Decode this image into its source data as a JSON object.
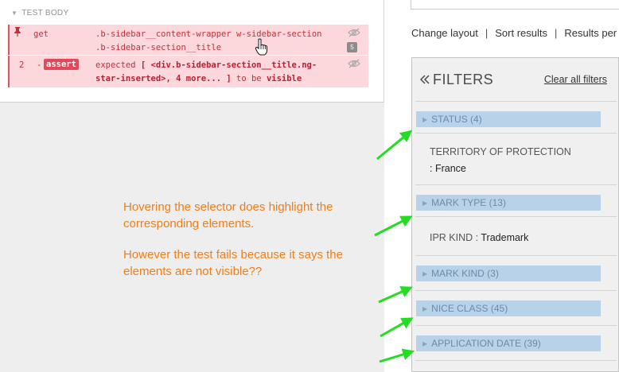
{
  "cypress": {
    "section_label": "TEST BODY",
    "command1": {
      "name": "get",
      "selector_line1": ".b-sidebar__content-wrapper w-sidebar-section",
      "selector_line2": ".b-sidebar-section__title",
      "count": "5"
    },
    "command2": {
      "number": "2",
      "dash": "-",
      "name": "assert",
      "msg_line1_a": "expected",
      "msg_line1_b": "[ <div.b-sidebar-section__title.ng-",
      "msg_line2_a": "star-inserted>, 4 more... ]",
      "msg_line2_b": "to be",
      "msg_line2_c": "visible"
    }
  },
  "annotation": {
    "line1": "Hovering the selector does highlight the corresponding elements.",
    "line2": "However the test fails because it says the elements are not visible??"
  },
  "app": {
    "layout_bar": {
      "change_layout": "Change layout",
      "separator": "|",
      "sort_results": "Sort results",
      "results_per": "Results per"
    },
    "filters": {
      "title": "FILTERS",
      "clear_all": "Clear all filters",
      "status": "STATUS (4)",
      "territory_label": "TERRITORY OF PROTECTION",
      "territory_value": ": France",
      "mark_type": "MARK TYPE (13)",
      "ipr_label": "IPR KIND : ",
      "ipr_value": "Trademark",
      "mark_kind": "MARK KIND (3)",
      "nice_class": "NICE CLASS (45)",
      "application_date": "APPLICATION DATE (39)"
    }
  },
  "colors": {
    "cypress_fail_bg": "#fcd7db",
    "cypress_fail_text": "#c0303e",
    "assert_badge": "#e2475a",
    "annotation_text": "#f07e18",
    "facet_highlight": "#b8d2ea",
    "arrow_green": "#22dd22"
  }
}
